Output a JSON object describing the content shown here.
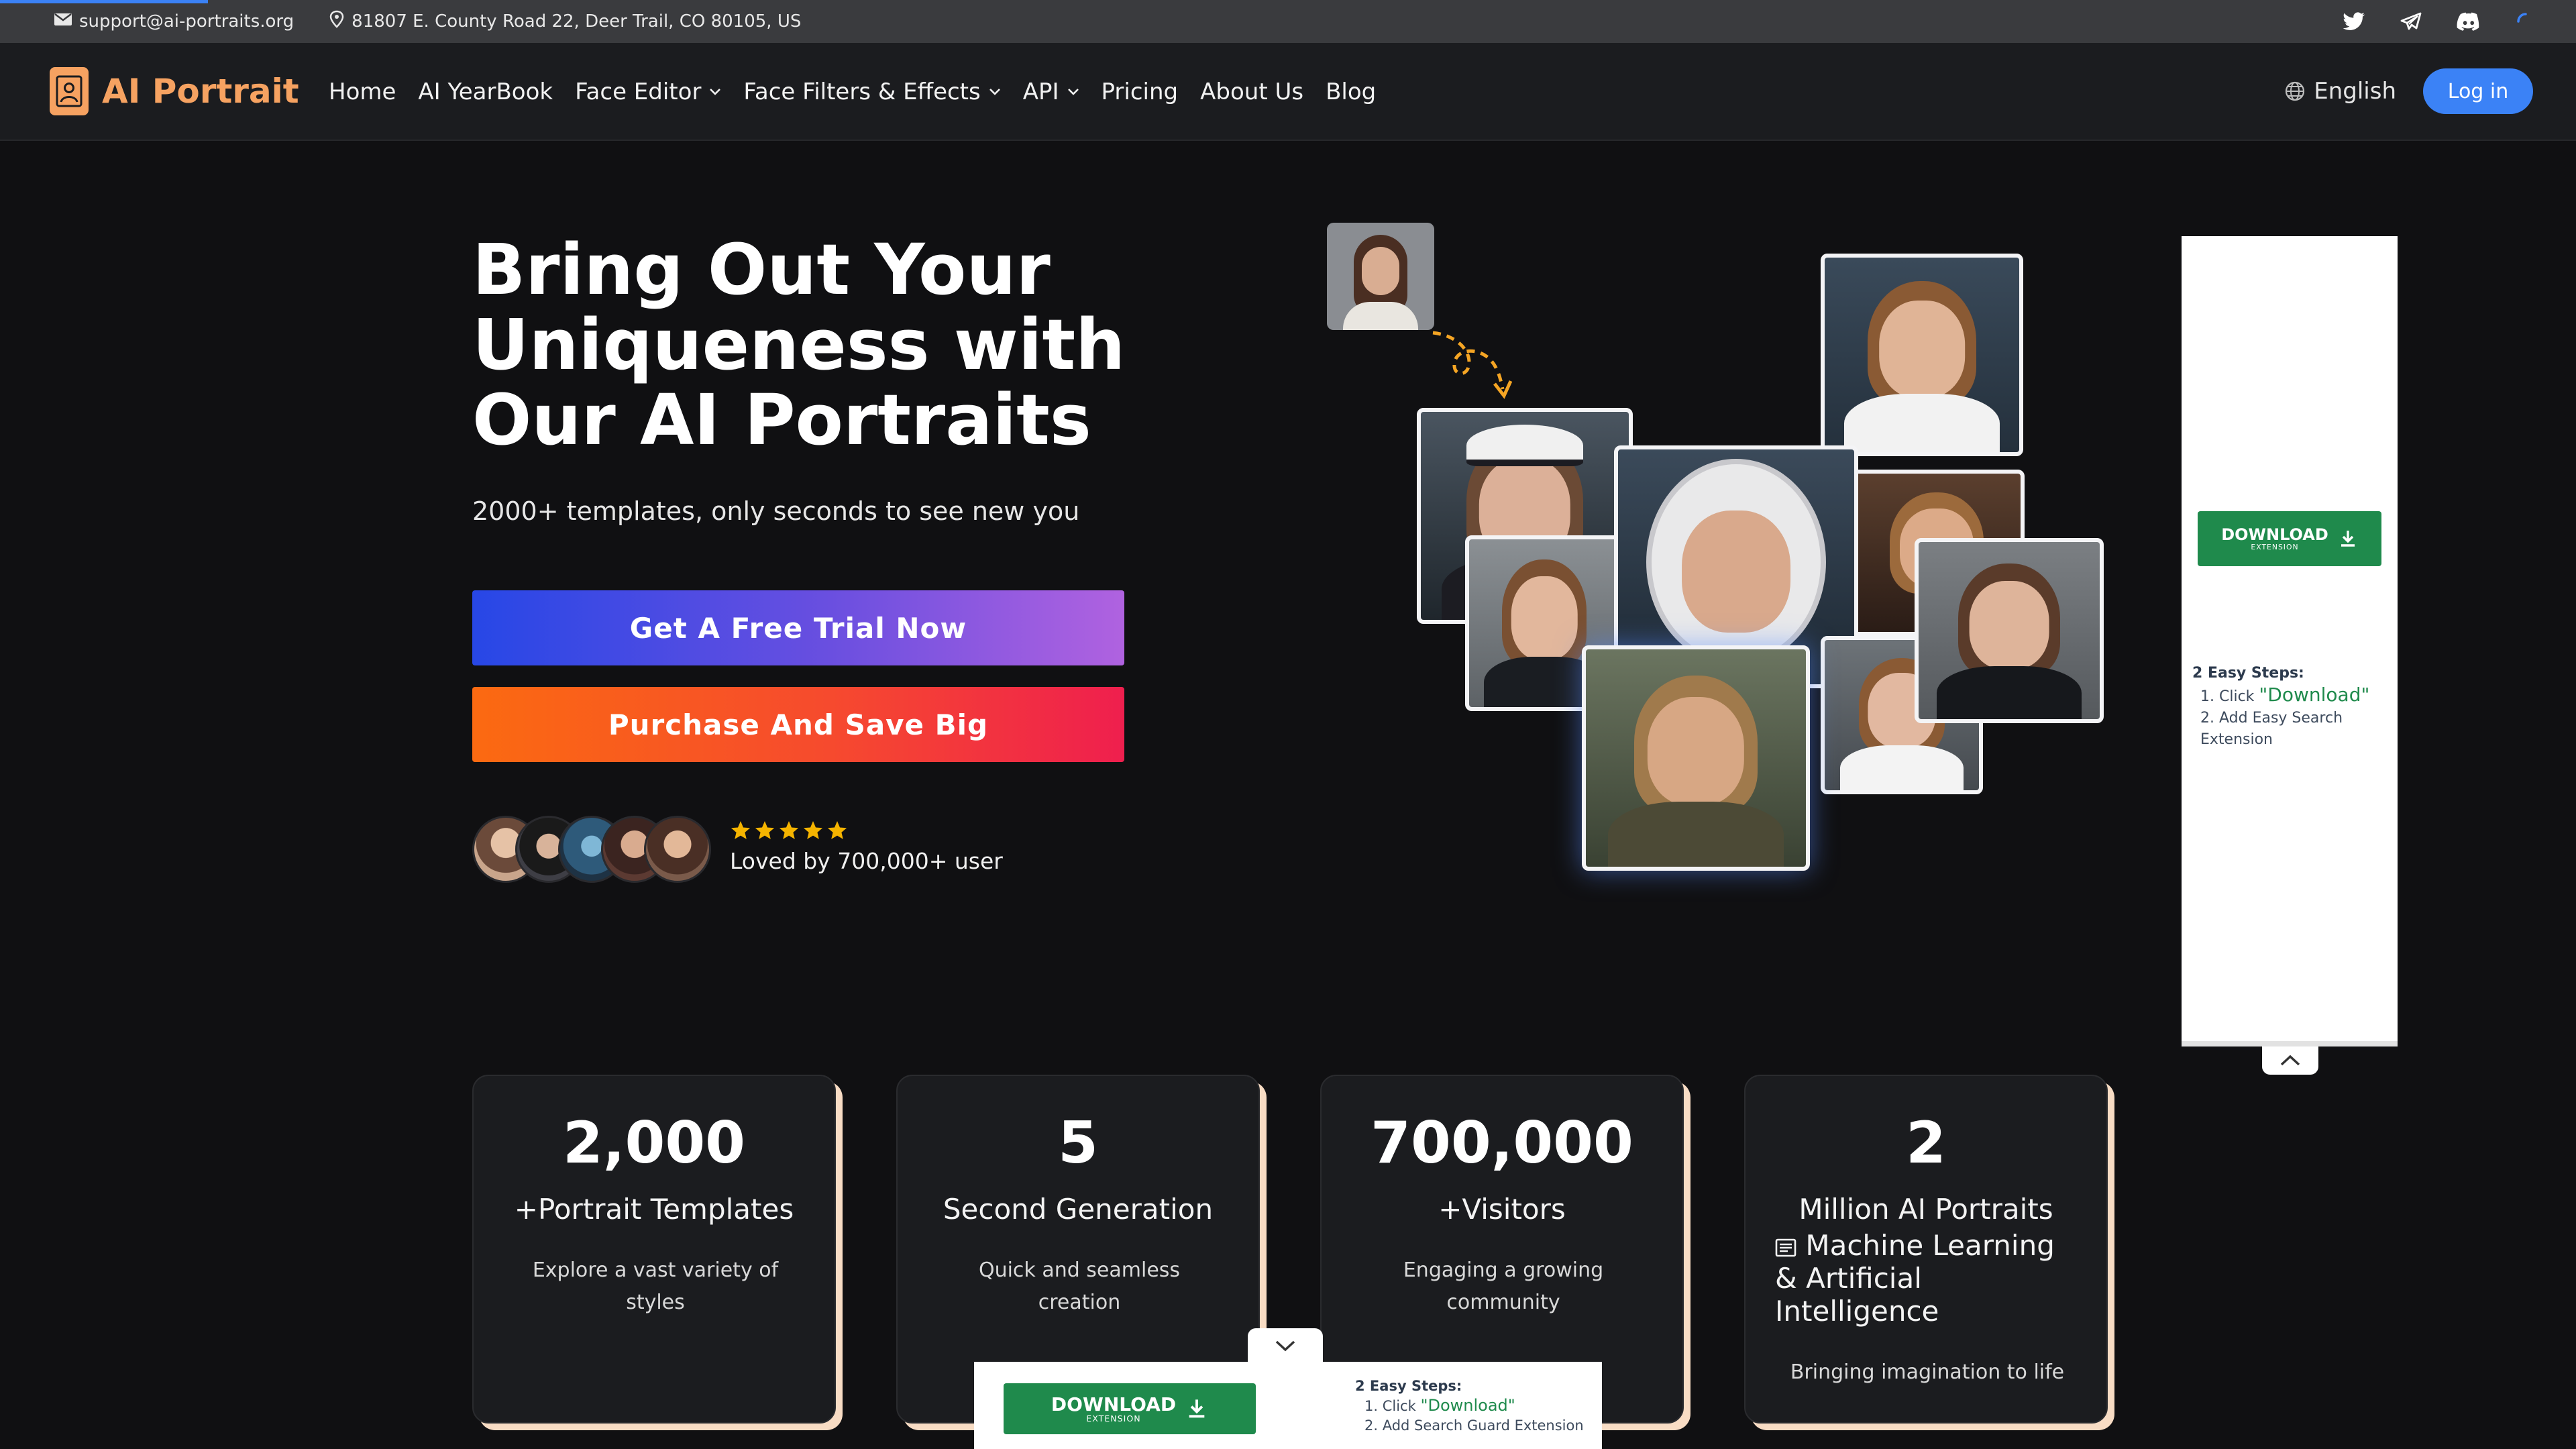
{
  "topbar": {
    "email": "support@ai-portraits.org",
    "address": "81807 E. County Road 22, Deer Trail, CO 80105, US",
    "socials": [
      "twitter-icon",
      "telegram-icon",
      "discord-icon"
    ]
  },
  "nav": {
    "brand": "AI Portrait",
    "items": [
      {
        "label": "Home",
        "dropdown": false
      },
      {
        "label": "AI YearBook",
        "dropdown": false
      },
      {
        "label": "Face Editor",
        "dropdown": true
      },
      {
        "label": "Face Filters & Effects",
        "dropdown": true
      },
      {
        "label": "API",
        "dropdown": true
      },
      {
        "label": "Pricing",
        "dropdown": false
      },
      {
        "label": "About Us",
        "dropdown": false
      },
      {
        "label": "Blog",
        "dropdown": false
      }
    ],
    "language": "English",
    "login": "Log in"
  },
  "hero": {
    "title": "Bring Out Your Uniqueness with Our AI Portraits",
    "subtitle": "2000+ templates, only seconds to see new you",
    "cta_trial": "Get A Free Trial Now",
    "cta_buy": "Purchase And Save Big",
    "rating": 5,
    "loved": "Loved by 700,000+ user"
  },
  "stats": [
    {
      "number": "2,000",
      "label": "+Portrait Templates",
      "desc": "Explore a vast variety of styles"
    },
    {
      "number": "5",
      "label": "Second Generation",
      "desc": "Quick and seamless creation"
    },
    {
      "number": "700,000",
      "label": "+Visitors",
      "desc": "Engaging a growing community"
    },
    {
      "number": "2",
      "label": "Million AI Portraits",
      "overlay": "Machine Learning & Artificial Intelligence",
      "desc": "Bringing imagination to life"
    }
  ],
  "side_ad": {
    "button": "DOWNLOAD",
    "button_sub": "EXTENSION",
    "steps_title": "2 Easy Steps:",
    "step1_prefix": "1. Click ",
    "step1_highlight": "\"Download\"",
    "step2": "2. Add Easy Search Extension"
  },
  "bottom_ad": {
    "button": "DOWNLOAD",
    "button_sub": "EXTENSION",
    "steps_title": "2 Easy Steps:",
    "step1_prefix": "1. Click ",
    "step1_highlight": "\"Download\"",
    "step2": "2. Add Search Guard Extension"
  },
  "colors": {
    "brand": "#f6a261",
    "login": "#3b82f6",
    "ad_green": "#1f8a4c",
    "card_shadow": "#f8dcc4"
  }
}
